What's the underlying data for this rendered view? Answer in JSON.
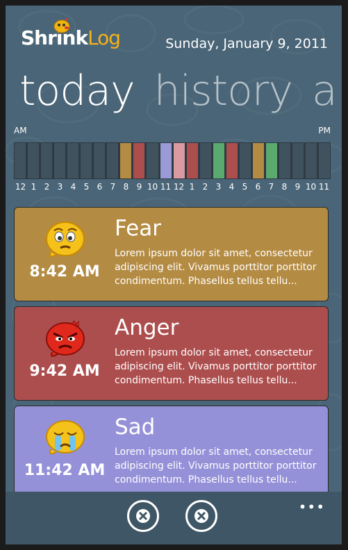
{
  "app": {
    "logo_part1": "Shrink",
    "logo_part2": "Log"
  },
  "header": {
    "date": "Sunday, January 9, 2011"
  },
  "pivot": {
    "items": [
      "today",
      "history",
      "a"
    ]
  },
  "timeline": {
    "am_label": "AM",
    "pm_label": "PM",
    "hours": [
      "12",
      "1",
      "2",
      "3",
      "4",
      "5",
      "6",
      "7",
      "8",
      "9",
      "10",
      "11",
      "12",
      "1",
      "2",
      "3",
      "4",
      "5",
      "6",
      "7",
      "8",
      "9",
      "10",
      "11"
    ],
    "slot_colors": [
      "#41525f",
      "#41525f",
      "#41525f",
      "#41525f",
      "#41525f",
      "#41525f",
      "#41525f",
      "#41525f",
      "#b48b42",
      "#ad4e4e",
      "#41525f",
      "#9a9ad6",
      "#d99aa2",
      "#ad4e4e",
      "#41525f",
      "#5aa96f",
      "#ad4e4e",
      "#41525f",
      "#b48b42",
      "#5aa96f",
      "#41525f",
      "#41525f",
      "#41525f",
      "#41525f"
    ]
  },
  "entries": [
    {
      "title": "Fear",
      "time": "8:42 AM",
      "color": "#b48b42",
      "icon": "worried-face-icon",
      "text": "Lorem ipsum dolor sit amet, consectetur adipiscing elit. Vivamus porttitor porttitor condimentum. Phasellus tellus tellu..."
    },
    {
      "title": "Anger",
      "time": "9:42 AM",
      "color": "#ad4e4e",
      "icon": "angry-face-icon",
      "text": "Lorem ipsum dolor sit amet, consectetur adipiscing elit. Vivamus porttitor porttitor condimentum. Phasellus tellus tellu..."
    },
    {
      "title": "Sad",
      "time": "11:42 AM",
      "color": "#9591d8",
      "icon": "crying-face-icon",
      "text": "Lorem ipsum dolor sit amet, consectetur adipiscing elit. Vivamus porttitor porttitor condimentum. Phasellus tellus tellu..."
    }
  ],
  "appbar": {
    "ellipsis": "•••"
  }
}
